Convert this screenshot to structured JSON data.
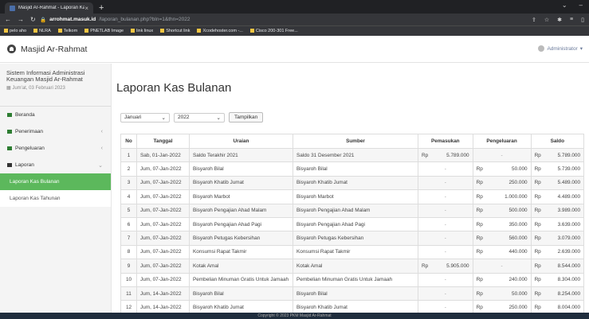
{
  "browser": {
    "tab_title": "Masjid Ar-Rahmat - Laporan Kas",
    "new_tab": "+",
    "domain": "arrohmat.masuk.id",
    "path": "/laporan_bulanan.php?bln=1&thn=2022",
    "bookmarks": [
      "pelo aho",
      "NLRA",
      "Telkom",
      "PNETLAB Image",
      "link linux",
      "Shortcut link",
      "Xcodehoster.com -...",
      "Cisco 200-301 Free..."
    ]
  },
  "app": {
    "name": "Masjid Ar-Rahmat",
    "user": "Administrator"
  },
  "sidebar": {
    "title": "Sistem Informasi Administrasi Keuangan Masjid Ar-Rahmat",
    "date": "Jum'at, 03 Februari 2023",
    "items": [
      {
        "label": "Beranda"
      },
      {
        "label": "Penerimaan"
      },
      {
        "label": "Pengeluaran"
      },
      {
        "label": "Laporan"
      }
    ],
    "subitems": [
      {
        "label": "Laporan Kas Bulanan"
      },
      {
        "label": "Laporan Kas Tahunan"
      }
    ]
  },
  "main": {
    "title": "Laporan Kas Bulanan",
    "month": "Januari",
    "year": "2022",
    "button": "Tampilkan"
  },
  "table": {
    "headers": [
      "No",
      "Tanggal",
      "Uraian",
      "Sumber",
      "Pemasukan",
      "Pengeluaran",
      "Saldo"
    ],
    "rows": [
      {
        "no": "1",
        "tanggal": "Sab, 01-Jan-2022",
        "uraian": "Saldo Terakhir 2021",
        "sumber": "Saldo 31 Desember 2021",
        "masuk": "5.789.000",
        "keluar": "",
        "saldo": "5.789.000"
      },
      {
        "no": "2",
        "tanggal": "Jum, 07-Jan-2022",
        "uraian": "Bisyaroh Bilal",
        "sumber": "Bisyaroh Bilal",
        "masuk": "",
        "keluar": "50.000",
        "saldo": "5.739.000"
      },
      {
        "no": "3",
        "tanggal": "Jum, 07-Jan-2022",
        "uraian": "Bisyaroh Khatib Jumat",
        "sumber": "Bisyaroh Khatib Jumat",
        "masuk": "",
        "keluar": "250.000",
        "saldo": "5.489.000"
      },
      {
        "no": "4",
        "tanggal": "Jum, 07-Jan-2022",
        "uraian": "Bisyaroh Marbot",
        "sumber": "Bisyaroh Marbot",
        "masuk": "",
        "keluar": "1.000.000",
        "saldo": "4.489.000"
      },
      {
        "no": "5",
        "tanggal": "Jum, 07-Jan-2022",
        "uraian": "Bisyaroh Pengajian Ahad Malam",
        "sumber": "Bisyaroh Pengajian Ahad Malam",
        "masuk": "",
        "keluar": "500.000",
        "saldo": "3.989.000"
      },
      {
        "no": "6",
        "tanggal": "Jum, 07-Jan-2022",
        "uraian": "Bisyaroh Pengajian Ahad Pagi",
        "sumber": "Bisyaroh Pengajian Ahad Pagi",
        "masuk": "",
        "keluar": "350.000",
        "saldo": "3.639.000"
      },
      {
        "no": "7",
        "tanggal": "Jum, 07-Jan-2022",
        "uraian": "Bisyaroh Petugas Kebersihan",
        "sumber": "Bisyaroh Petugas Kebersihan",
        "masuk": "",
        "keluar": "560.000",
        "saldo": "3.079.000"
      },
      {
        "no": "8",
        "tanggal": "Jum, 07-Jan-2022",
        "uraian": "Konsumsi Rapat Takmir",
        "sumber": "Konsumsi Rapat Takmir",
        "masuk": "",
        "keluar": "440.000",
        "saldo": "2.639.000"
      },
      {
        "no": "9",
        "tanggal": "Jum, 07-Jan-2022",
        "uraian": "Kotak Amal",
        "sumber": "Kotak Amal",
        "masuk": "5.905.000",
        "keluar": "",
        "saldo": "8.544.000"
      },
      {
        "no": "10",
        "tanggal": "Jum, 07-Jan-2022",
        "uraian": "Pembelian Minuman Gratis Untuk Jamaah",
        "sumber": "Pembelian Minuman Gratis Untuk Jamaah",
        "masuk": "",
        "keluar": "240.000",
        "saldo": "8.304.000"
      },
      {
        "no": "11",
        "tanggal": "Jum, 14-Jan-2022",
        "uraian": "Bisyaroh Bilal",
        "sumber": "Bisyaroh Bilal",
        "masuk": "",
        "keluar": "50.000",
        "saldo": "8.254.000"
      },
      {
        "no": "12",
        "tanggal": "Jum, 14-Jan-2022",
        "uraian": "Bisyaroh Khatib Jumat",
        "sumber": "Bisyaroh Khatib Jumat",
        "masuk": "",
        "keluar": "250.000",
        "saldo": "8.004.000"
      }
    ],
    "currency": "Rp",
    "dash": "-"
  },
  "footer": "Copyright © 2023 PKM Masjid Ar-Rahmat"
}
